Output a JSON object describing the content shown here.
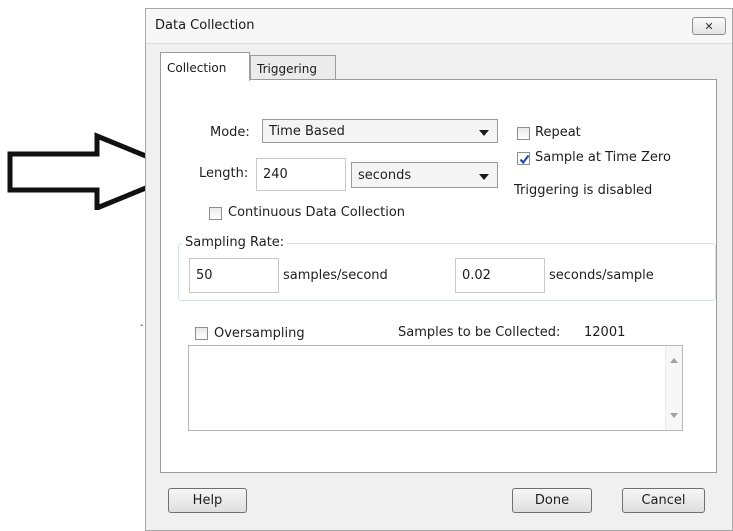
{
  "dialog": {
    "title": "Data Collection",
    "close_glyph": "✕",
    "tabs": [
      {
        "label": "Collection",
        "active": true
      },
      {
        "label": "Triggering",
        "active": false
      }
    ]
  },
  "collection": {
    "mode_label": "Mode:",
    "mode_value": "Time Based",
    "length_label": "Length:",
    "length_value": "240",
    "length_unit": "seconds",
    "repeat_label": "Repeat",
    "repeat_checked": false,
    "sample_zero_label": "Sample at Time Zero",
    "sample_zero_checked": true,
    "trigger_status": "Triggering is disabled",
    "continuous_label": "Continuous Data Collection",
    "continuous_checked": false,
    "sampling_rate": {
      "legend": "Sampling Rate:",
      "rate_value": "50",
      "rate_unit": "samples/second",
      "interval_value": "0.02",
      "interval_unit": "seconds/sample"
    },
    "oversampling_label": "Oversampling",
    "oversampling_checked": false,
    "samples_label": "Samples to be Collected:",
    "samples_value": "12001"
  },
  "buttons": {
    "help": "Help",
    "done": "Done",
    "cancel": "Cancel"
  },
  "icons": {
    "arrow": "right-arrow-outline-icon",
    "checkmark": "checkmark-icon",
    "dropdown": "chevron-down-icon"
  }
}
